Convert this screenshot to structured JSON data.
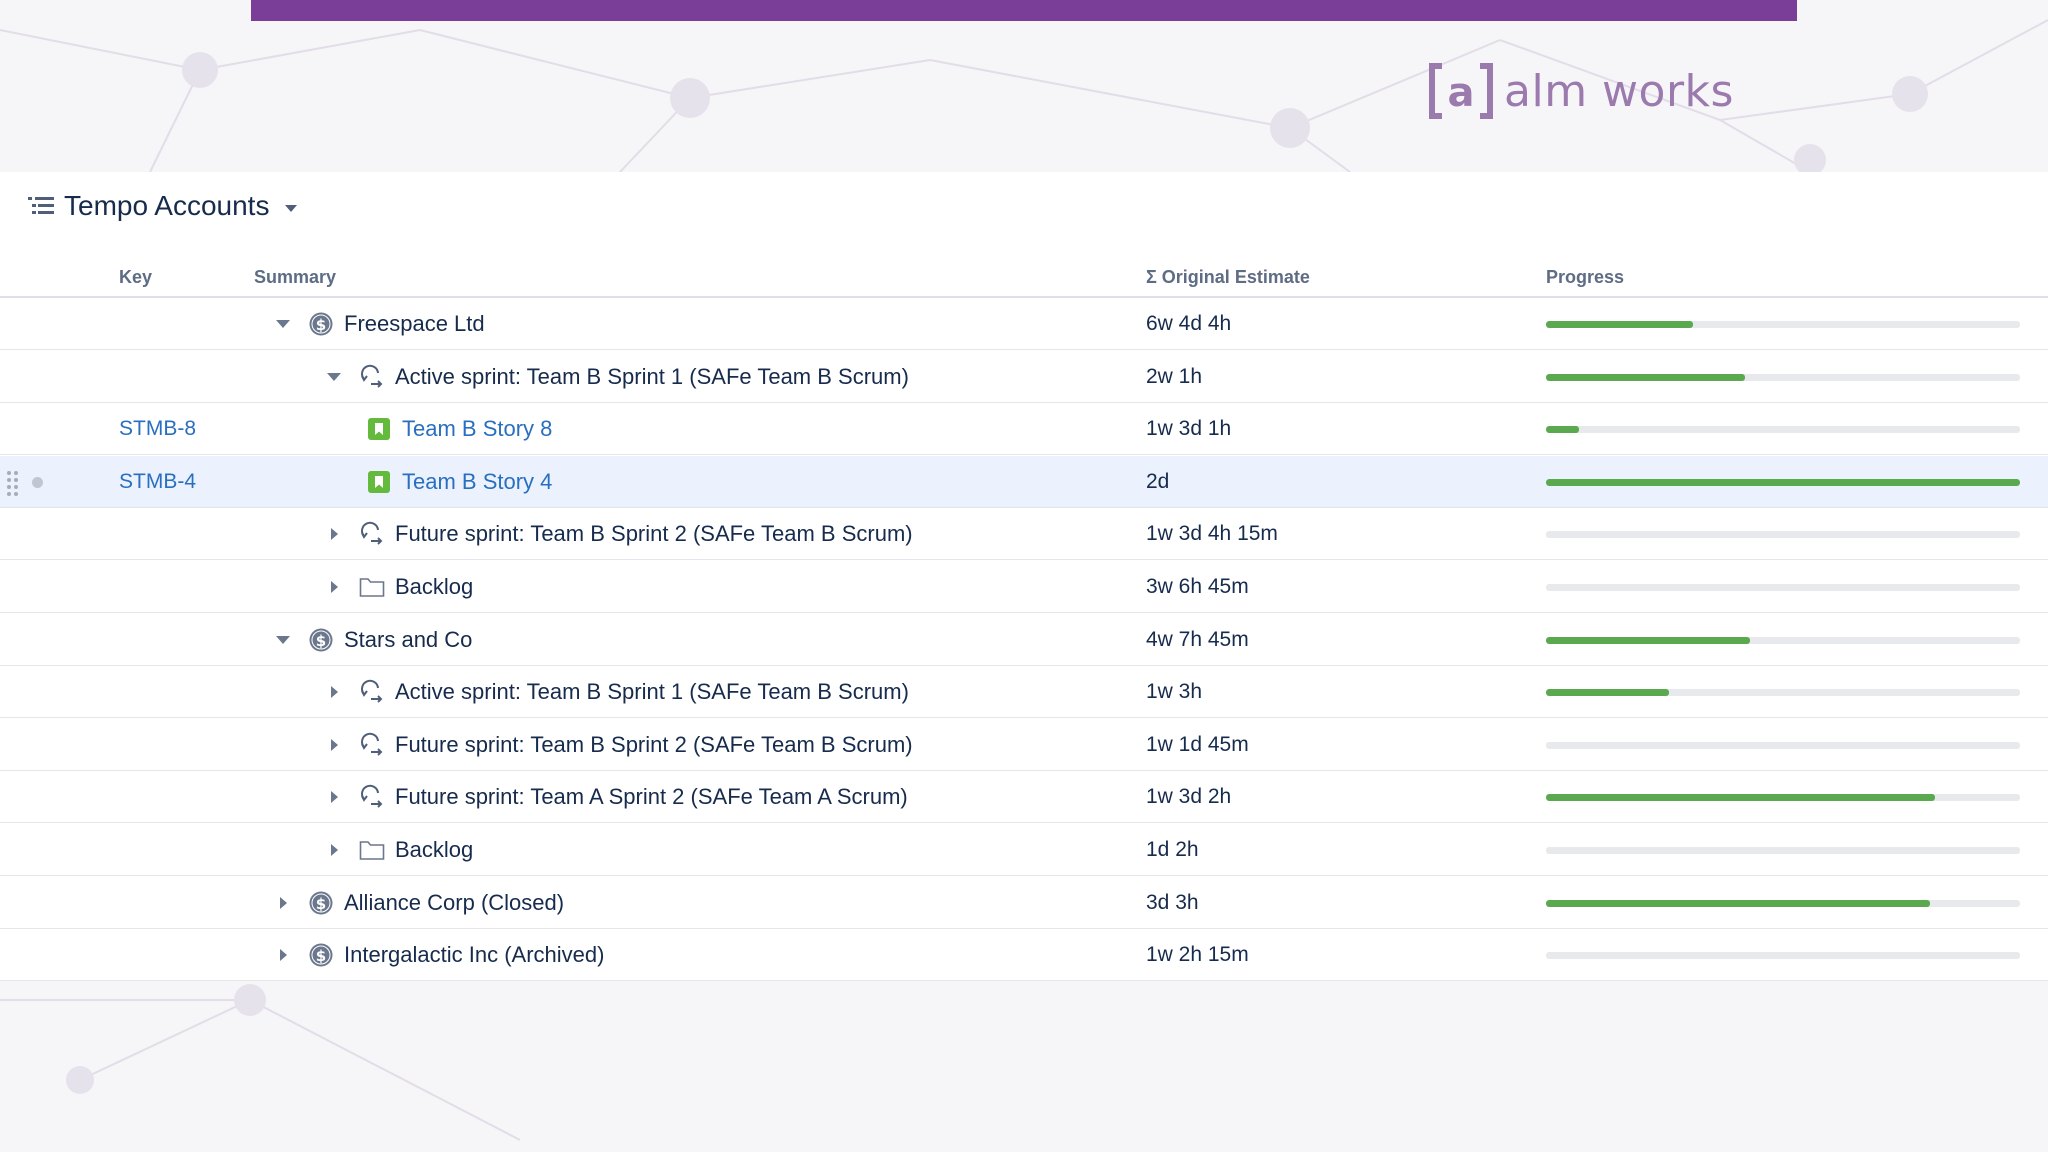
{
  "brand": {
    "logo_text": "alm works",
    "accent_color": "#7a3d98"
  },
  "structure": {
    "title": "Tempo Accounts",
    "icon": "structure-list-icon",
    "menu_icon": "caret-down-icon"
  },
  "columns": {
    "key": "Key",
    "summary": "Summary",
    "estimate": "Σ Original Estimate",
    "progress": "Progress"
  },
  "rows": [
    {
      "key": "",
      "summary": "Freespace Ltd",
      "icon": "account-dollar-icon",
      "toggle": "expanded",
      "depth": 0,
      "estimate": "6w 4d 4h",
      "progress": 0.31,
      "selected": false
    },
    {
      "key": "",
      "summary": "Active sprint: Team B Sprint 1 (SAFe Team B Scrum)",
      "icon": "sprint-icon",
      "toggle": "expanded",
      "depth": 1,
      "estimate": "2w 1h",
      "progress": 0.42,
      "selected": false
    },
    {
      "key": "STMB-8",
      "summary": "Team B Story 8",
      "icon": "story-icon",
      "toggle": "none",
      "depth": 2,
      "estimate": "1w 3d 1h",
      "progress": 0.07,
      "selected": false
    },
    {
      "key": "STMB-4",
      "summary": "Team B Story 4",
      "icon": "story-icon",
      "toggle": "none",
      "depth": 2,
      "estimate": "2d",
      "progress": 1.0,
      "selected": true
    },
    {
      "key": "",
      "summary": "Future sprint: Team B Sprint 2 (SAFe Team B Scrum)",
      "icon": "sprint-icon",
      "toggle": "collapsed",
      "depth": 1,
      "estimate": "1w 3d 4h 15m",
      "progress": 0,
      "selected": false
    },
    {
      "key": "",
      "summary": "Backlog",
      "icon": "folder-icon",
      "toggle": "collapsed",
      "depth": 1,
      "estimate": "3w 6h 45m",
      "progress": 0,
      "selected": false
    },
    {
      "key": "",
      "summary": "Stars and Co",
      "icon": "account-dollar-icon",
      "toggle": "expanded",
      "depth": 0,
      "estimate": "4w 7h 45m",
      "progress": 0.43,
      "selected": false
    },
    {
      "key": "",
      "summary": "Active sprint: Team B Sprint 1 (SAFe Team B Scrum)",
      "icon": "sprint-icon",
      "toggle": "collapsed",
      "depth": 1,
      "estimate": "1w 3h",
      "progress": 0.26,
      "selected": false
    },
    {
      "key": "",
      "summary": "Future sprint: Team B Sprint 2 (SAFe Team B Scrum)",
      "icon": "sprint-icon",
      "toggle": "collapsed",
      "depth": 1,
      "estimate": "1w 1d 45m",
      "progress": 0,
      "selected": false
    },
    {
      "key": "",
      "summary": "Future sprint: Team A Sprint 2 (SAFe Team A Scrum)",
      "icon": "sprint-icon",
      "toggle": "collapsed",
      "depth": 1,
      "estimate": "1w 3d 2h",
      "progress": 0.82,
      "selected": false
    },
    {
      "key": "",
      "summary": "Backlog",
      "icon": "folder-icon",
      "toggle": "collapsed",
      "depth": 1,
      "estimate": "1d 2h",
      "progress": 0,
      "selected": false
    },
    {
      "key": "",
      "summary": "Alliance Corp (Closed)",
      "icon": "account-dollar-icon",
      "toggle": "collapsed",
      "depth": 0,
      "estimate": "3d 3h",
      "progress": 0.81,
      "selected": false
    },
    {
      "key": "",
      "summary": "Intergalactic Inc (Archived)",
      "icon": "account-dollar-icon",
      "toggle": "collapsed",
      "depth": 0,
      "estimate": "1w 2h 15m",
      "progress": 0,
      "selected": false
    }
  ]
}
